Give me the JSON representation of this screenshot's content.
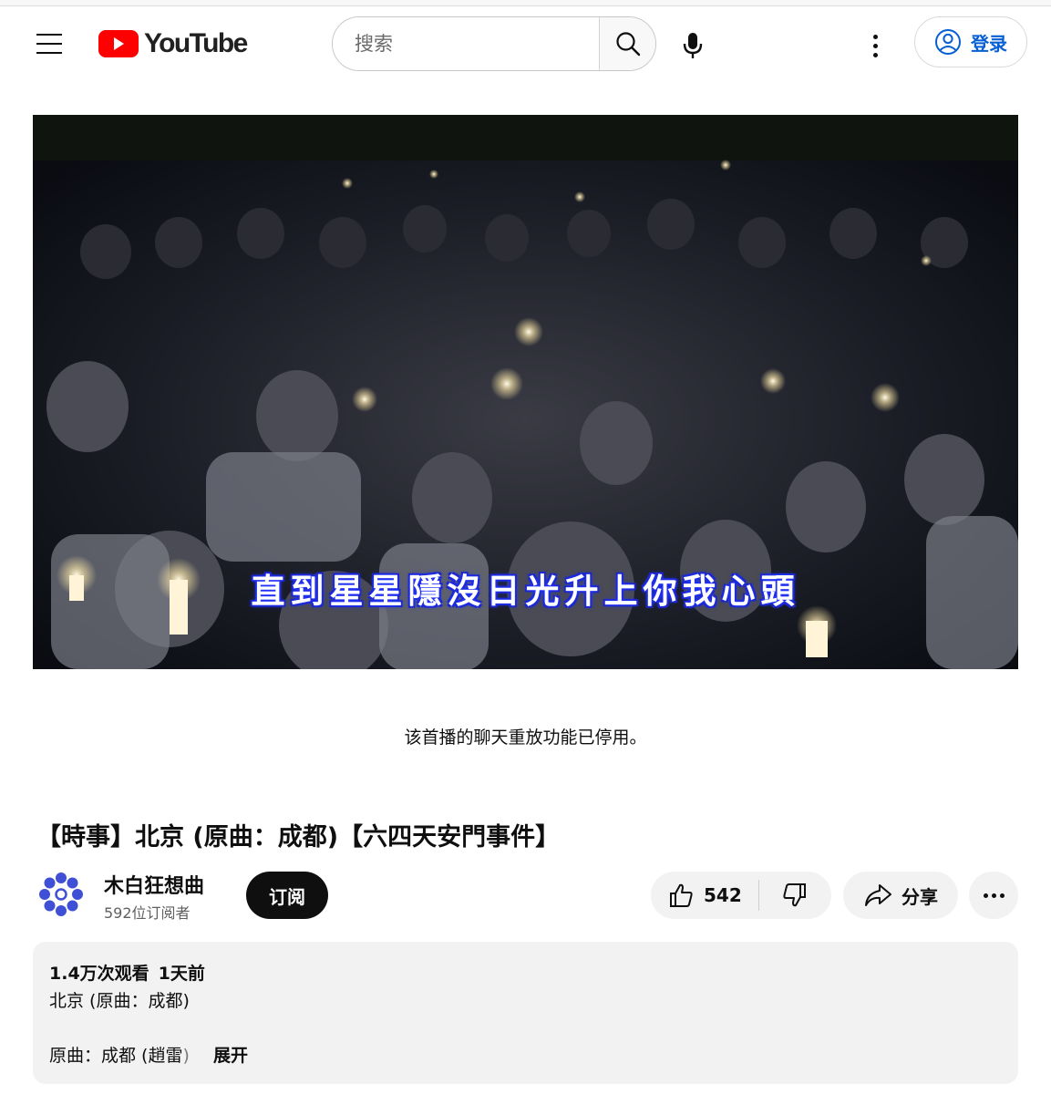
{
  "header": {
    "logo_text": "YouTube",
    "search_placeholder": "搜索",
    "signin_label": "登录"
  },
  "video": {
    "subtitle": "直到星星隱沒日光升上你我心頭",
    "chat_replay_notice": "该首播的聊天重放功能已停用。"
  },
  "title": "【時事】北京 (原曲：成都)【六四天安門事件】",
  "channel": {
    "name": "木白狂想曲",
    "subscribers": "592位订阅者",
    "subscribe_label": "订阅"
  },
  "actions": {
    "like_count": "542",
    "share_label": "分享"
  },
  "description": {
    "views": "1.4万次观看",
    "published": "1天前",
    "line1": "北京 (原曲：成都)",
    "line2": "原曲：成都 (趙雷",
    "line2_fade": ")",
    "expand_label": "展开"
  },
  "colors": {
    "brand_red": "#ff0000",
    "link_blue": "#065fd4",
    "subtitle_glow": "#2436ff"
  }
}
